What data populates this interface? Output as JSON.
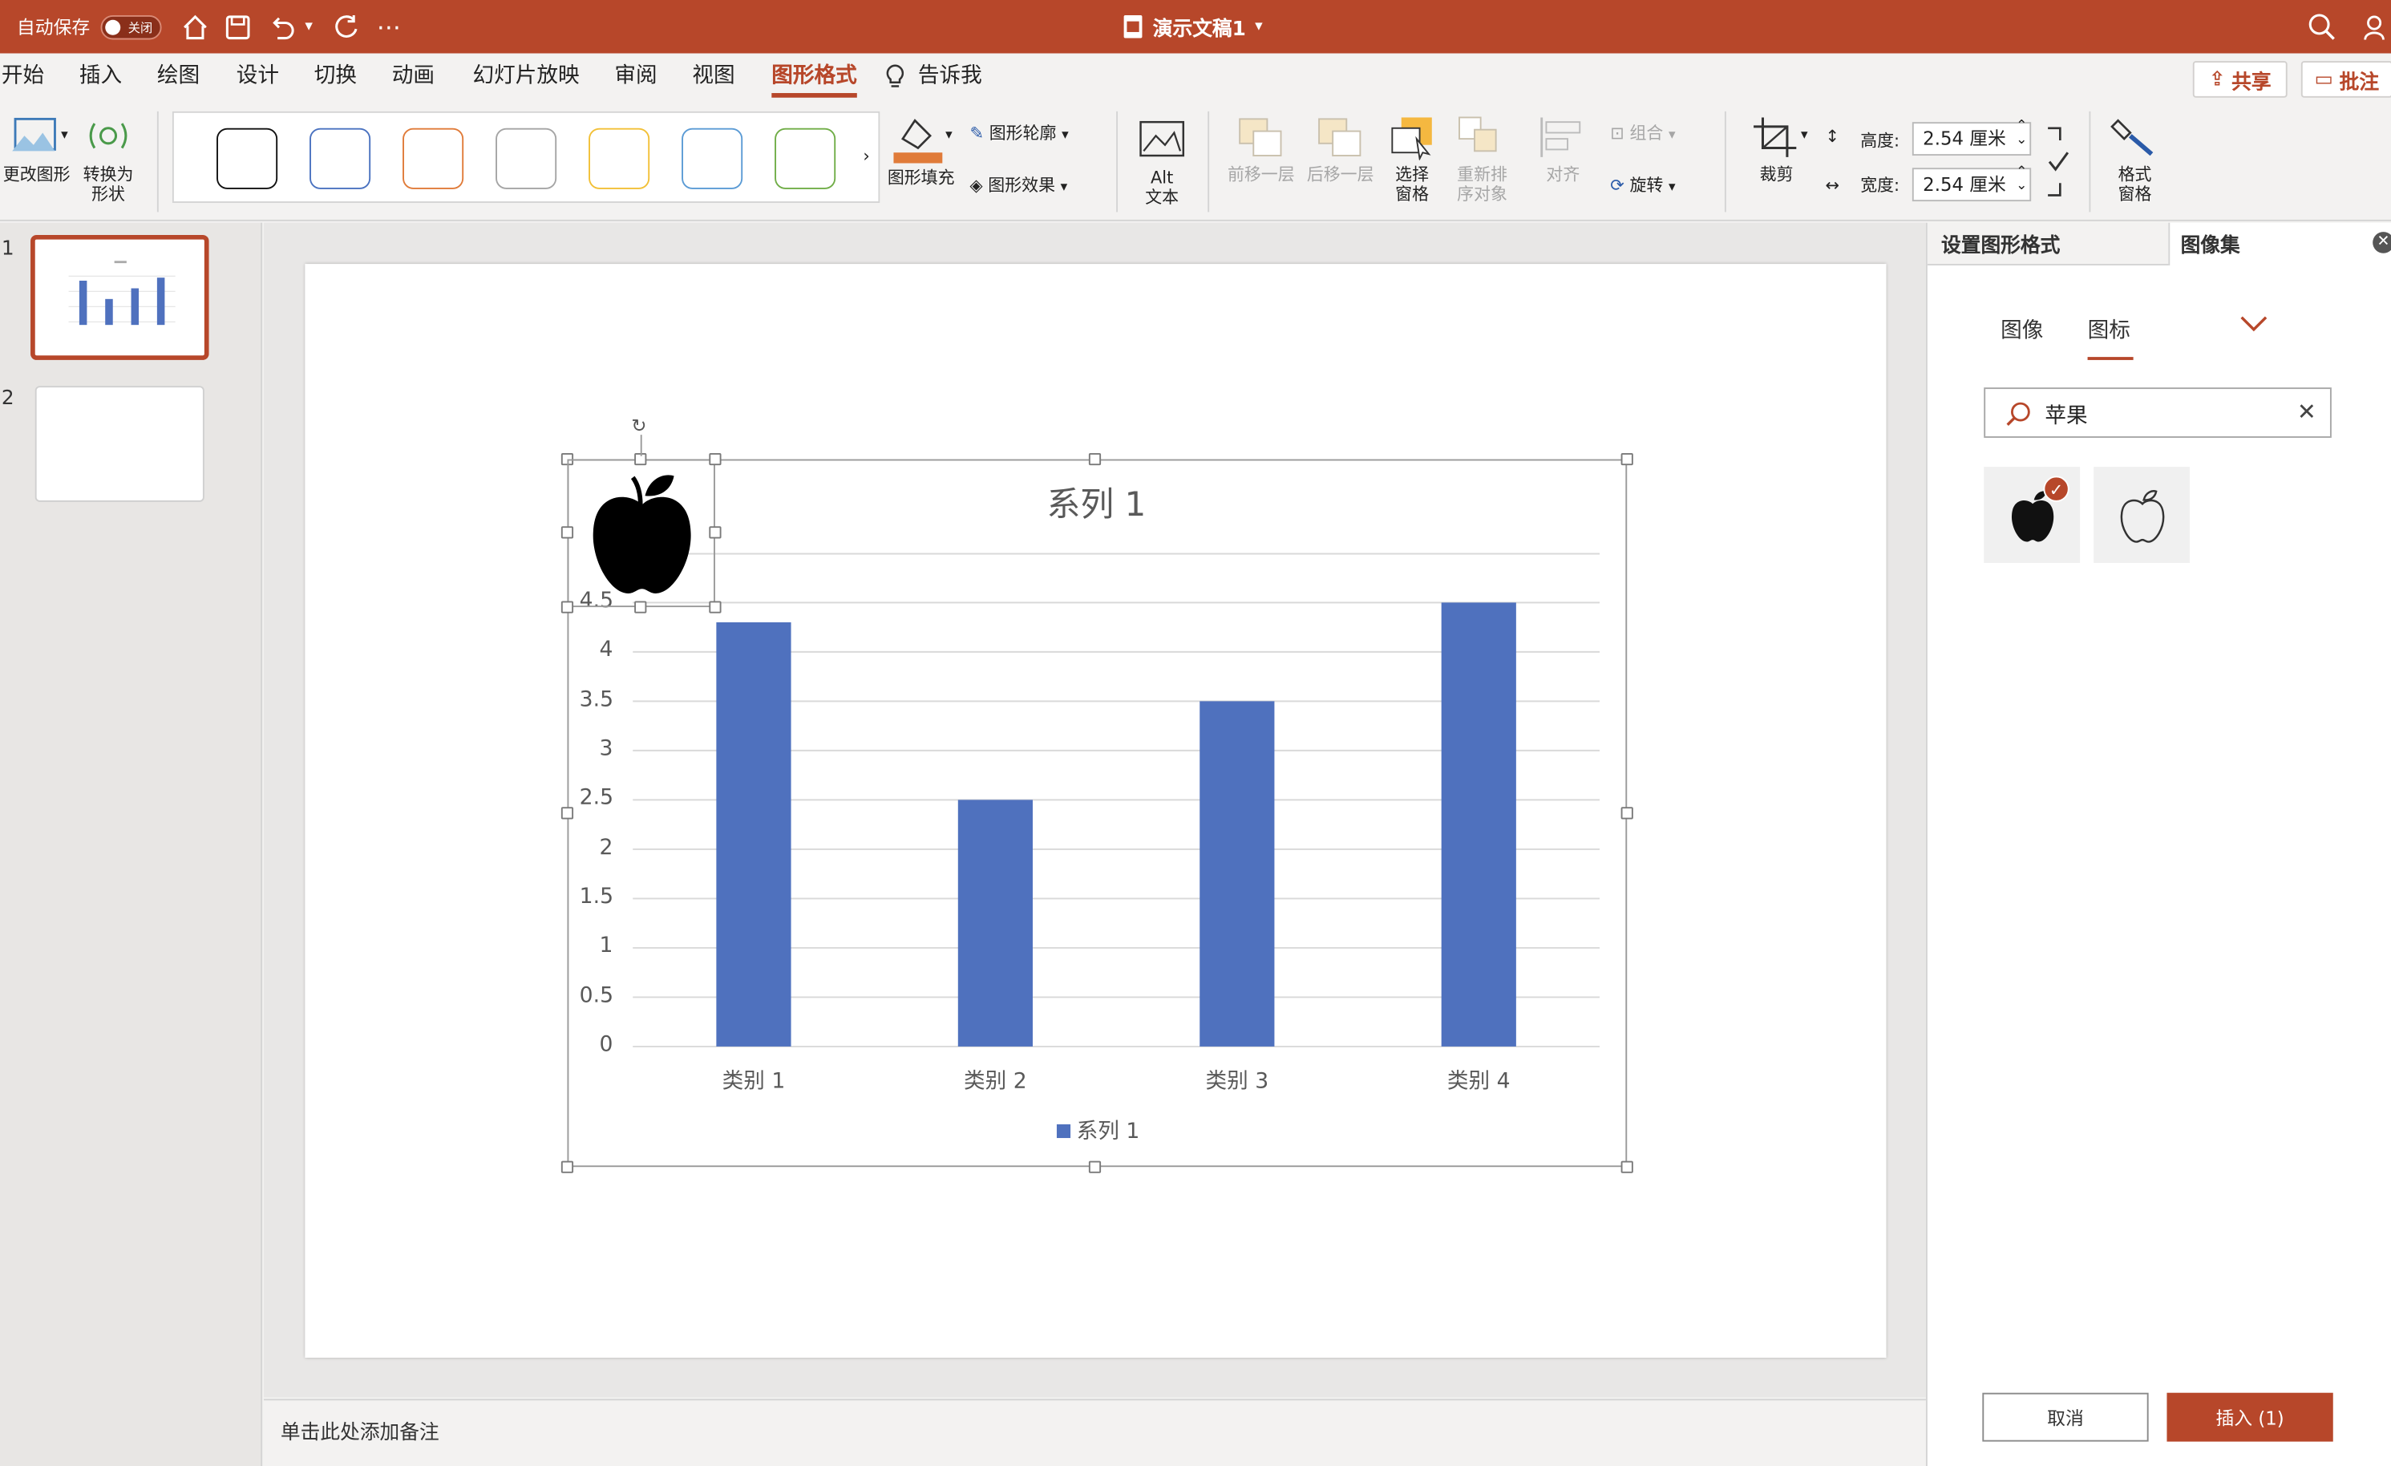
{
  "titlebar": {
    "autosave_label": "自动保存",
    "autosave_state": "关闭",
    "doc_title": "演示文稿1"
  },
  "tabs": [
    "开始",
    "插入",
    "绘图",
    "设计",
    "切换",
    "动画",
    "幻灯片放映",
    "审阅",
    "视图",
    "图形格式"
  ],
  "active_tab": "图形格式",
  "tell_me": "告诉我",
  "share_label": "共享",
  "comments_label": "批注",
  "ribbon": {
    "change_shape": "更改图形",
    "convert_to_shape_1": "转换为",
    "convert_to_shape_2": "形状",
    "shape_fill": "图形填充",
    "shape_outline": "图形轮廓",
    "shape_effects": "图形效果",
    "alt_text_1": "Alt",
    "alt_text_2": "文本",
    "bring_forward": "前移一层",
    "send_backward": "后移一层",
    "selection_pane_1": "选择",
    "selection_pane_2": "窗格",
    "reorder_1": "重新排",
    "reorder_2": "序对象",
    "align": "对齐",
    "group": "组合",
    "rotate": "旋转",
    "crop": "裁剪",
    "height_label": "高度:",
    "height_value": "2.54 厘米",
    "width_label": "宽度:",
    "width_value": "2.54 厘米",
    "format_pane_1": "格式",
    "format_pane_2": "窗格"
  },
  "slides": {
    "numbers": [
      "1",
      "2"
    ]
  },
  "chart_data": {
    "type": "bar",
    "title": "系列 1",
    "categories": [
      "类别 1",
      "类别 2",
      "类别 3",
      "类别 4"
    ],
    "series": [
      {
        "name": "系列 1",
        "values": [
          4.3,
          2.5,
          3.5,
          4.5
        ],
        "color": "#4f71be"
      }
    ],
    "ylim": [
      0,
      4.5
    ],
    "yticks": [
      "0",
      "0.5",
      "1",
      "1.5",
      "2",
      "2.5",
      "3",
      "3.5",
      "4",
      "4.5"
    ],
    "grid": true,
    "legend": "bottom"
  },
  "notes_placeholder": "单击此处添加备注",
  "panel": {
    "tab_format": "设置图形格式",
    "tab_images": "图像集",
    "subtab_images": "图像",
    "subtab_icons": "图标",
    "search_value": "苹果",
    "cancel": "取消",
    "insert": "插入 (1)"
  },
  "colors": {
    "accent": "#b7472a",
    "bar": "#4f71be"
  }
}
